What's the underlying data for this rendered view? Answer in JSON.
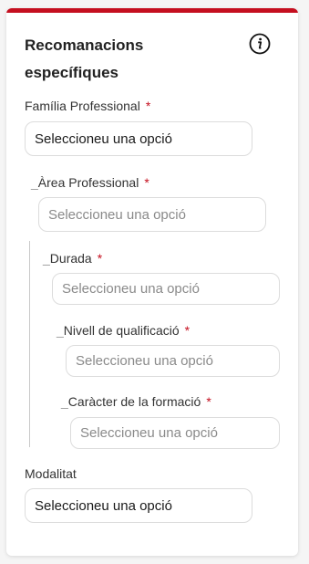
{
  "colors": {
    "accent": "#c50f1f",
    "placeholder": "#8a8a8a"
  },
  "panel": {
    "title": "Recomanacions específiques",
    "info_icon": "info-circle-icon"
  },
  "fields": {
    "familia": {
      "label": "Família Professional",
      "required_mark": "*",
      "value": "Seleccioneu una opció"
    },
    "area": {
      "prefix": "_",
      "label": "Àrea Professional",
      "required_mark": "*",
      "placeholder": "Seleccioneu una opció"
    },
    "durada": {
      "prefix": "_",
      "label": "Durada",
      "required_mark": "*",
      "placeholder": "Seleccioneu una opció"
    },
    "nivell": {
      "prefix": "_",
      "label": "Nivell de qualificació",
      "required_mark": "*",
      "placeholder": "Seleccioneu una opció"
    },
    "caracter": {
      "prefix": "_",
      "label": "Caràcter de la formació",
      "required_mark": "*",
      "placeholder": "Seleccioneu una opció"
    },
    "modalitat": {
      "label": "Modalitat",
      "value": "Seleccioneu una opció"
    }
  }
}
